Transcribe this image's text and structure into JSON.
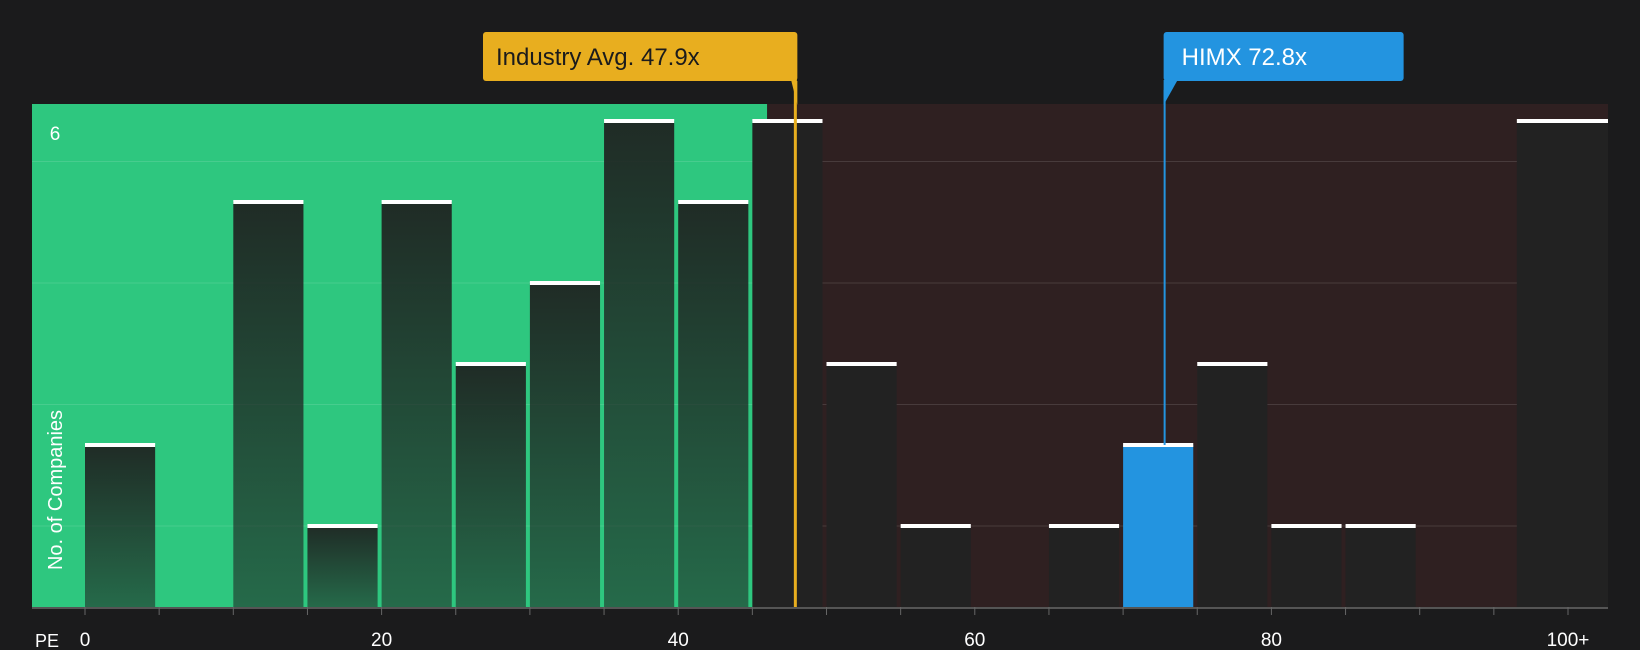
{
  "chart_data": {
    "type": "bar",
    "xlabel": "PE",
    "ylabel": "No. of Companies",
    "x_ticks": [
      "0",
      "20",
      "40",
      "60",
      "80",
      "100+"
    ],
    "y_tick_labels": [
      "6"
    ],
    "ylim": [
      0,
      6
    ],
    "xlim": [
      0,
      100
    ],
    "bin_width": 5,
    "bins": [
      {
        "x0": 0,
        "value": 2
      },
      {
        "x0": 5,
        "value": 0
      },
      {
        "x0": 10,
        "value": 5
      },
      {
        "x0": 15,
        "value": 1
      },
      {
        "x0": 20,
        "value": 5
      },
      {
        "x0": 25,
        "value": 3
      },
      {
        "x0": 30,
        "value": 4
      },
      {
        "x0": 35,
        "value": 6
      },
      {
        "x0": 40,
        "value": 5
      },
      {
        "x0": 45,
        "value": 6
      },
      {
        "x0": 50,
        "value": 3
      },
      {
        "x0": 55,
        "value": 1
      },
      {
        "x0": 60,
        "value": 0
      },
      {
        "x0": 65,
        "value": 1
      },
      {
        "x0": 70,
        "value": 2
      },
      {
        "x0": 75,
        "value": 3
      },
      {
        "x0": 80,
        "value": 1
      },
      {
        "x0": 85,
        "value": 1
      },
      {
        "x0": 90,
        "value": 0
      },
      {
        "x0": 95,
        "value": 0
      },
      {
        "x0": 100,
        "value": 6
      }
    ],
    "highlight_bin": 70,
    "markers": [
      {
        "id": "industry",
        "label": "Industry Avg. 47.9x",
        "value": 47.9,
        "color": "#e8ae1f"
      },
      {
        "id": "himx",
        "label": "HIMX 72.8x",
        "value": 72.8,
        "color": "#2394e0"
      }
    ],
    "regions": {
      "good_color": "#2ec77f",
      "bad_color": "#2f2021"
    },
    "colors": {
      "background": "#1b1b1c",
      "bar": "#222222",
      "highlight_bar": "#2394e0",
      "bar_cap": "#ffffff",
      "text": "#ffffff"
    }
  }
}
